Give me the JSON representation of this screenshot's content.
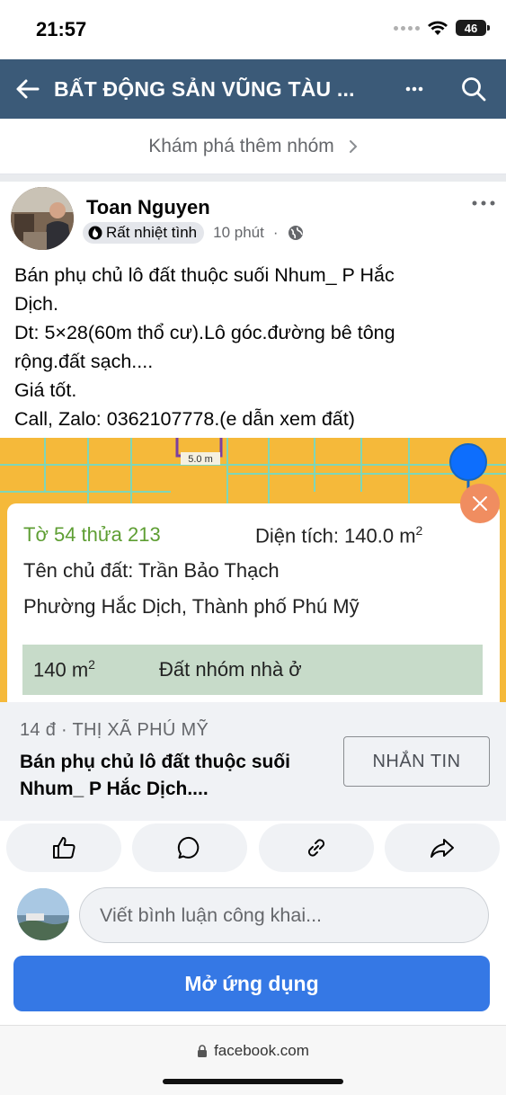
{
  "status_bar": {
    "time": "21:57",
    "battery": "46"
  },
  "header": {
    "title": "BẤT ĐỘNG SẢN VŨNG TÀU ..."
  },
  "discover": {
    "label": "Khám phá thêm nhóm"
  },
  "post": {
    "author": "Toan Nguyen",
    "badge": "Rất nhiệt tình",
    "time": "10 phút",
    "separator": "·",
    "lines": [
      "Bán phụ chủ lô đất thuộc suối Nhum_ P Hắc",
      "Dịch.",
      "Dt: 5×28(60m thổ cư).Lô góc.đường bê tông",
      "rộng.đất sạch....",
      "Giá tốt.",
      "Call, Zalo: 0362107778.(e dẫn xem đất)"
    ]
  },
  "map": {
    "scale_label": "5.0 m",
    "parcel": "Tờ 54 thửa 213",
    "area_label": "Diện tích: 140.0 m",
    "area_sup": "2",
    "owner": "Tên chủ đất: Trần Bảo Thạch",
    "ward": "Phường Hắc Dịch, Thành phố Phú Mỹ",
    "land_size": "140 m",
    "land_size_sup": "2",
    "land_type": "Đất nhóm nhà ở"
  },
  "link": {
    "domain": "14 đ · THỊ XÃ PHÚ MỸ",
    "title": "Bán phụ chủ lô đất thuộc suối Nhum_ P Hắc Dịch....",
    "button": "NHẮN TIN"
  },
  "comment": {
    "placeholder": "Viết bình luận công khai..."
  },
  "open_app": {
    "label": "Mở ứng dụng"
  },
  "browser": {
    "url": "facebook.com"
  },
  "colors": {
    "header_bg": "#3b5a78",
    "primary_button": "#3578e5",
    "map_bg": "#f5b93a",
    "parcel_green": "#5e9e33"
  }
}
